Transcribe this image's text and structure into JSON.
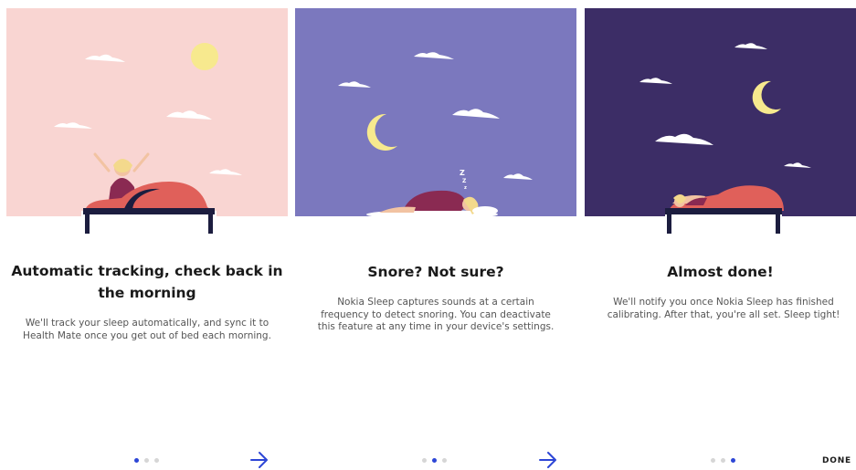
{
  "slides": [
    {
      "title": "Automatic tracking, check back in the morning",
      "description": "We'll track your sleep automatically, and sync it to Health Mate once you get out of bed each morning.",
      "background_color": "#f9d5d2"
    },
    {
      "title": "Snore? Not sure?",
      "description": "Nokia Sleep captures sounds at a certain frequency to detect snoring. You can deactivate this feature at any time in your device's settings.",
      "background_color": "#7b78be"
    },
    {
      "title": "Almost done!",
      "description": "We'll notify you once Nokia Sleep has finished calibrating. After that, you're all set. Sleep tight!",
      "background_color": "#3c2d66"
    }
  ],
  "pagination": {
    "slide_1_active": 0,
    "slide_2_active": 1,
    "slide_3_active": 2,
    "total": 3
  },
  "controls": {
    "next_icon": "arrow-right-icon",
    "done_label": "DONE"
  },
  "colors": {
    "accent": "#2d46d6",
    "moon": "#f7e98e",
    "blanket": "#e0605a",
    "bed_frame": "#1c1d3f"
  }
}
